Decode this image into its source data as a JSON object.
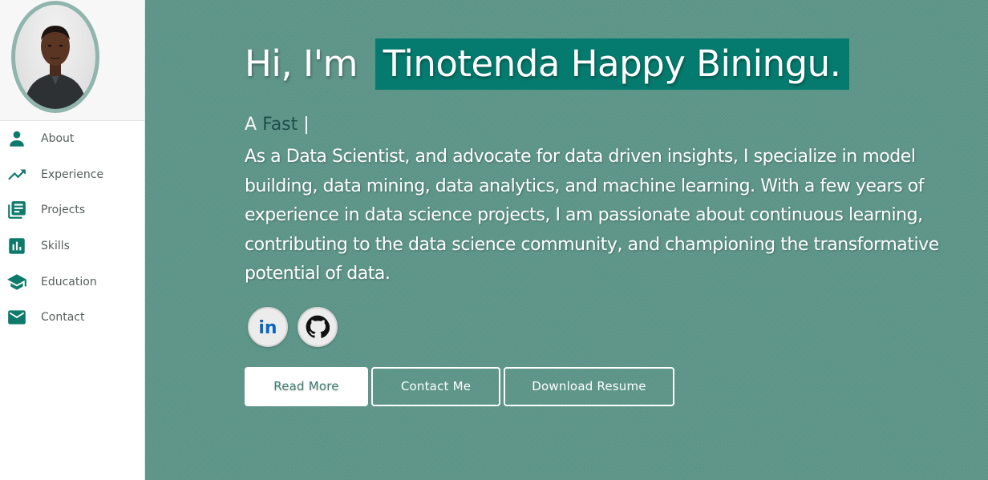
{
  "sidebar": {
    "nav": [
      {
        "label": "About",
        "icon": "person-icon"
      },
      {
        "label": "Experience",
        "icon": "trending-up-icon"
      },
      {
        "label": "Projects",
        "icon": "library-books-icon"
      },
      {
        "label": "Skills",
        "icon": "bar-chart-icon"
      },
      {
        "label": "Education",
        "icon": "graduation-cap-icon"
      },
      {
        "label": "Contact",
        "icon": "mail-icon"
      }
    ]
  },
  "hero": {
    "greeting": "Hi, I'm",
    "name": "Tinotenda Happy Biningu.",
    "typed_prefix": "A",
    "typed_word": "Fast",
    "typed_cursor": "|",
    "bio": "As a Data Scientist, and advocate for data driven insights, I specialize in model building, data mining, data analytics, and machine learning. With a few years of experience in data science projects, I am passionate about continuous learning, contributing to the data science community, and championing the transformative potential of data.",
    "socials": [
      {
        "icon": "linkedin-icon",
        "text": "in"
      },
      {
        "icon": "github-icon"
      }
    ],
    "buttons": {
      "read_more": "Read More",
      "contact": "Contact Me",
      "resume": "Download Resume"
    }
  },
  "colors": {
    "accent": "#047b6e",
    "background": "#5e968a",
    "icon": "#0e7a6b"
  }
}
